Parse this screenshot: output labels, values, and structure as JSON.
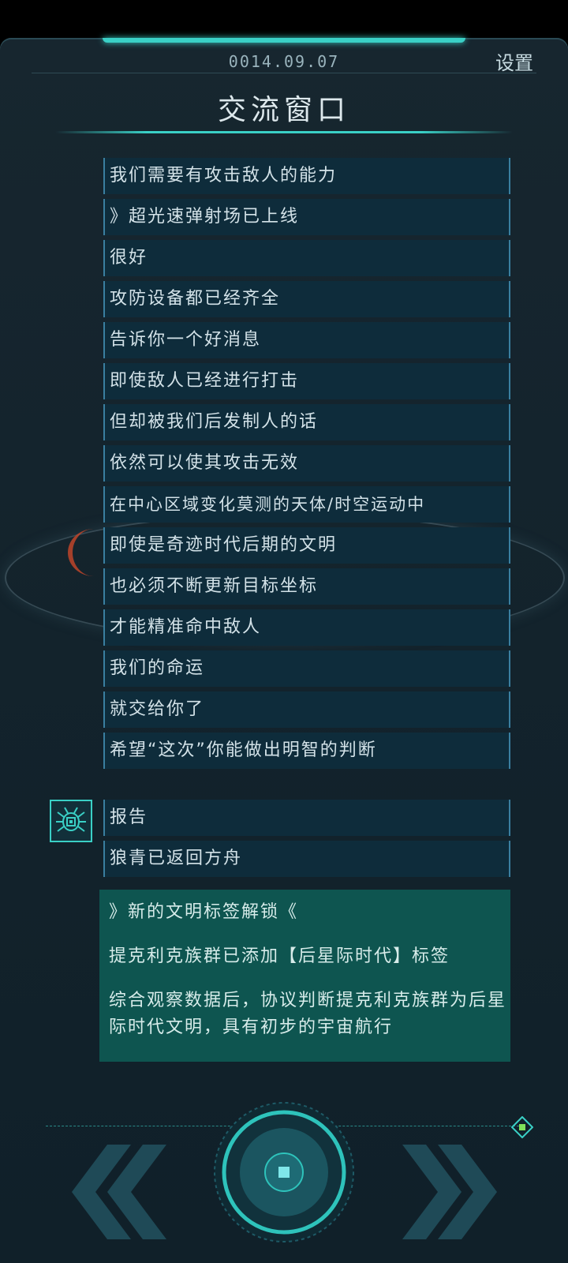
{
  "header": {
    "date": "0014.09.07",
    "settings_label": "设置",
    "title": "交流窗口"
  },
  "messages": [
    "我们需要有攻击敌人的能力",
    "》超光速弹射场已上线",
    "很好",
    "攻防设备都已经齐全",
    "告诉你一个好消息",
    "即使敌人已经进行打击",
    "但却被我们后发制人的话",
    "依然可以使其攻击无效",
    "在中心区域变化莫测的天体/时空运动中",
    "即使是奇迹时代后期的文明",
    "也必须不断更新目标坐标",
    "才能精准命中敌人",
    "我们的命运",
    "就交给你了",
    "希望“这次”你能做出明智的判断"
  ],
  "report_messages": [
    "报告",
    "狼青已返回方舟"
  ],
  "unlock": {
    "title": "》新的文明标签解锁《",
    "tag_line": "提克利克族群已添加【后星际时代】标签",
    "body": "综合观察数据后，协议判断提克利克族群为后星际时代文明，具有初步的宇宙航行"
  },
  "controls": {
    "prev_icon": "double-chevron-left-icon",
    "next_icon": "double-chevron-right-icon",
    "center_icon": "target-button-icon",
    "avatar_icon": "chip-bug-icon"
  },
  "colors": {
    "accent": "#3ad0c6",
    "bubble": "#0e2c3b",
    "unlock_bg": "#0e5550"
  }
}
